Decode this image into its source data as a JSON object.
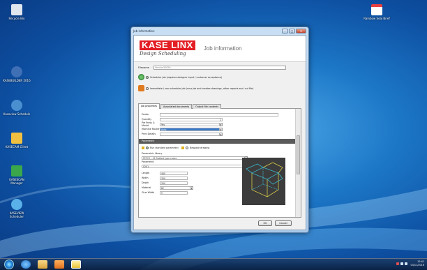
{
  "desktop": {
    "icons_left": [
      {
        "label": "Recycle Bin",
        "icon": "recycle-bin-icon",
        "color": "#dfe6ee"
      },
      {
        "label": "KASEBUILDER 2016",
        "icon": "kasebuilder-icon",
        "color": "#3f6fb5"
      },
      {
        "label": "Kaseview Schedule",
        "icon": "kaseview-icon",
        "color": "#4a90d0"
      },
      {
        "label": "KASECAM Client",
        "icon": "kasecam-icon",
        "color": "#f0c040"
      },
      {
        "label": "KASESCAN Manager",
        "icon": "kasescan-icon",
        "color": "#3aa84a"
      },
      {
        "label": "KASEVIEW Scheduler",
        "icon": "kaseview-scheduler-icon",
        "color": "#5ab0e8"
      }
    ],
    "icon_right": {
      "label": "Rainbow Seal Brief",
      "icon": "document-icon",
      "color": "#e84040"
    }
  },
  "window": {
    "title": "Job information",
    "controls": {
      "minimize": "–",
      "maximize": "□",
      "close": "✕"
    },
    "brand": {
      "logo": "KASE LINX",
      "subtitle": "Design Scheduling"
    },
    "banner_title": "Job information",
    "filename_label": "Filename",
    "filename_value": "Version5005b",
    "option1": "Scheduler job (requires designer input / customer acceptance)",
    "option2": "Immediate / non-scheduler job (runs job and creates drawings, other reports and .cut file)",
    "tabs": [
      "Job properties",
      "Associated documents",
      "Output file contents"
    ],
    "properties": [
      {
        "label": "Grade",
        "value": ""
      },
      {
        "label": "Quantity",
        "value": "1"
      },
      {
        "label": "Pre Press & Mould",
        "value": "Yes"
      },
      {
        "label": "Machine Router",
        "value": "Auto"
      },
      {
        "label": "Print Details",
        "value": ""
      }
    ],
    "section_parametric": "Parametric",
    "run_option_1": "Run standard parametric",
    "run_option_2": "Bespoke drawing",
    "param_library_label": "Parametric library",
    "param_library_value": "FEFCO - 02 Slotted type cases",
    "param_label": "Parametric",
    "param_value": "0201",
    "dimensions": [
      {
        "label": "Length",
        "value": "400"
      },
      {
        "label": "Width",
        "value": "350"
      },
      {
        "label": "Depth",
        "value": "300"
      },
      {
        "label": "Material",
        "value": "BC"
      },
      {
        "label": "Glue Width",
        "value": "5"
      }
    ],
    "ok_label": "OK",
    "cancel_label": "Cancel"
  },
  "taskbar": {
    "time": "12:41",
    "date": "03/11/2016"
  },
  "colors": {
    "accent_red": "#e31e24",
    "section_gray": "#5a5a5a"
  }
}
